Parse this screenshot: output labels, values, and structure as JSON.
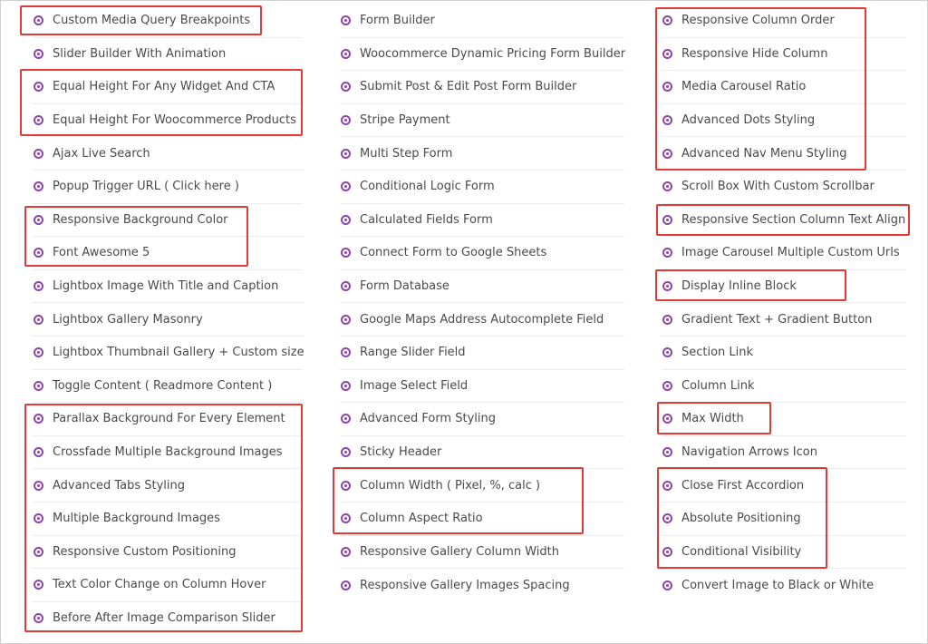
{
  "columns": [
    {
      "items": [
        "Custom Media Query Breakpoints",
        "Slider Builder With Animation",
        "Equal Height For Any Widget And CTA",
        "Equal Height For Woocommerce Products",
        "Ajax Live Search",
        "Popup Trigger URL ( Click here )",
        "Responsive Background Color",
        "Font Awesome 5",
        "Lightbox Image With Title and Caption",
        "Lightbox Gallery Masonry",
        "Lightbox Thumbnail Gallery + Custom size",
        "Toggle Content ( Readmore Content )",
        "Parallax Background For Every Element",
        "Crossfade Multiple Background Images",
        "Advanced Tabs Styling",
        "Multiple Background Images",
        "Responsive Custom Positioning",
        "Text Color Change on Column Hover",
        "Before After Image Comparison Slider"
      ]
    },
    {
      "items": [
        "Form Builder",
        "Woocommerce Dynamic Pricing Form Builder",
        "Submit Post & Edit Post Form Builder",
        "Stripe Payment",
        "Multi Step Form",
        "Conditional Logic Form",
        "Calculated Fields Form",
        "Connect Form to Google Sheets",
        "Form Database",
        "Google Maps Address Autocomplete Field",
        "Range Slider Field",
        "Image Select Field",
        "Advanced Form Styling",
        "Sticky Header",
        "Column Width ( Pixel, %, calc )",
        "Column Aspect Ratio",
        "Responsive Gallery Column Width",
        "Responsive Gallery Images Spacing"
      ]
    },
    {
      "items": [
        "Responsive Column Order",
        "Responsive Hide Column",
        "Media Carousel Ratio",
        "Advanced Dots Styling",
        "Advanced Nav Menu Styling",
        "Scroll Box With Custom Scrollbar",
        "Responsive Section Column Text Align",
        "Image Carousel Multiple Custom Urls",
        "Display Inline Block",
        "Gradient Text + Gradient Button",
        "Section Link",
        "Column Link",
        "Max Width",
        "Navigation Arrows Icon",
        "Close First Accordion",
        "Absolute Positioning",
        "Conditional Visibility",
        "Convert Image to Black or White"
      ]
    }
  ],
  "colors": {
    "bullet": "#8e44ad",
    "highlight": "#e53935",
    "text": "#4a4a4a"
  }
}
